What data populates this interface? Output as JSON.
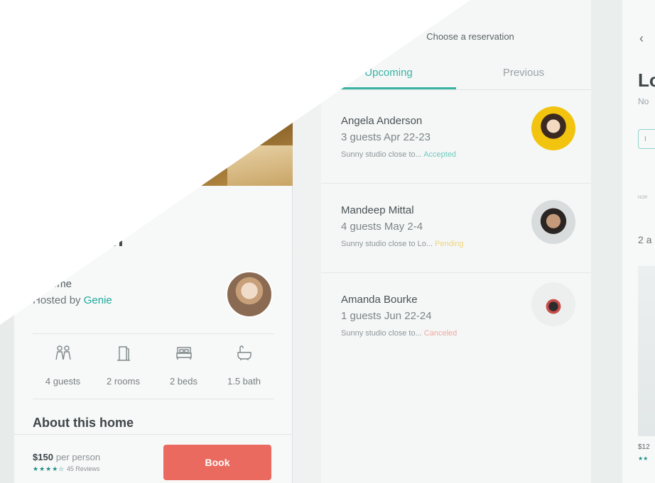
{
  "listing": {
    "title": "pen Floor\nu Kitchen",
    "home_type": "re home",
    "hosted_prefix": "Hosted by ",
    "host_name": "Genie",
    "amenities": [
      {
        "icon": "guests-icon",
        "label": "4 guests"
      },
      {
        "icon": "door-icon",
        "label": "2 rooms"
      },
      {
        "icon": "bed-icon",
        "label": "2 beds"
      },
      {
        "icon": "bathtub-icon",
        "label": "1.5 bath"
      }
    ],
    "about_heading": "About this home",
    "price": "$150",
    "price_unit": "per person",
    "stars": "★★★★☆",
    "reviews": "45 Reviews",
    "book_label": "Book",
    "accent_color": "#ea6a5f",
    "link_color": "#1fa99a"
  },
  "reservations": {
    "header": "Choose a reservation",
    "tabs": [
      {
        "label": "Upcoming",
        "active": true
      },
      {
        "label": "Previous",
        "active": false
      }
    ],
    "items": [
      {
        "name": "Angela Anderson",
        "meta": "3 guests   Apr 22-23",
        "desc": "Sunny studio close to... ",
        "status": "Accepted"
      },
      {
        "name": "Mandeep Mittal",
        "meta": "4 guests   May 2-4",
        "desc": "Sunny studio close to Lo... ",
        "status": "Pending"
      },
      {
        "name": "Amanda Bourke",
        "meta": "1 guests   Jun 22-24",
        "desc": "Sunny studio close to... ",
        "status": "Canceled"
      }
    ],
    "tab_color": "#39b3a4"
  },
  "detail": {
    "back": "‹",
    "title": "Lo",
    "subtitle": "No",
    "chip": "I",
    "small": "NOR",
    "count": "2 a",
    "price": "$12",
    "stars": "★★"
  }
}
